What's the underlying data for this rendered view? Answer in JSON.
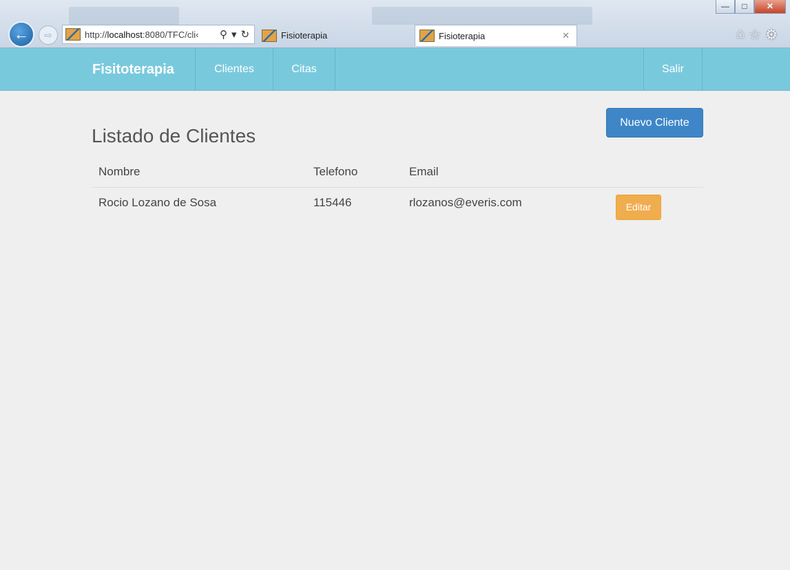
{
  "browser": {
    "url_prefix": "http://",
    "url_host": "localhost",
    "url_rest": ":8080/TFC/cli‹",
    "tabs": [
      {
        "title": "Fisioterapia",
        "active": false
      },
      {
        "title": "Fisioterapia",
        "active": true
      }
    ],
    "icons": {
      "back": "back-arrow-icon",
      "forward": "forward-arrow-icon",
      "search": "search-icon",
      "refresh": "refresh-icon",
      "home": "home-icon",
      "favorites": "star-icon",
      "settings": "gear-icon"
    }
  },
  "navbar": {
    "brand": "Fisitoterapia",
    "links": {
      "clientes": "Clientes",
      "citas": "Citas",
      "salir": "Salir"
    },
    "background": "#79c9dd"
  },
  "page": {
    "title": "Listado de Clientes",
    "new_button": "Nuevo Cliente"
  },
  "table": {
    "headers": {
      "nombre": "Nombre",
      "telefono": "Telefono",
      "email": "Email"
    },
    "rows": [
      {
        "nombre": "Rocio Lozano de Sosa",
        "telefono": "115446",
        "email": "rlozanos@everis.com",
        "action": "Editar"
      }
    ]
  },
  "colors": {
    "primary_button": "#3e86c8",
    "warning_button": "#f0ad4e",
    "page_background": "#efefef"
  }
}
